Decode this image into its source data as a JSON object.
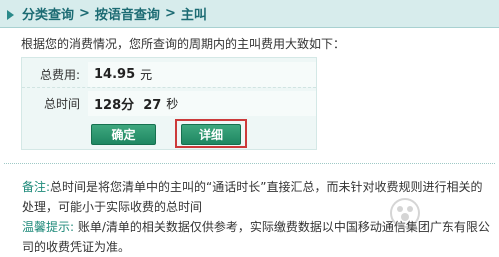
{
  "breadcrumb": {
    "items": [
      "分类查询",
      "按语音查询",
      "主叫"
    ],
    "separator": ">"
  },
  "intro": "根据您的消费情况，您所查询的周期内的主叫费用大致如下：",
  "summary": {
    "rows": [
      {
        "label": "总费用:",
        "value": "14.95",
        "unit": "元"
      },
      {
        "label": "总时间",
        "value": "128分  27",
        "unit": "秒"
      }
    ]
  },
  "buttons": {
    "confirm": "确定",
    "detail": "详细"
  },
  "notes": {
    "remark_key": "备注:",
    "remark_text": "总时间是将您清单中的主叫的“通话时长”直接汇总，而未针对收费规则进行相关的处理，可能小于实际收费的总时间",
    "tip_key": "温馨提示:",
    "tip_text": " 账单/清单的相关数据仅供参考，实际缴费数据以中国移动通信集团广东有限公司的收费凭证为准。"
  },
  "colors": {
    "header_bg": "#d7ecec",
    "accent": "#1c6b73",
    "button": "#2a9a70",
    "highlight": "#cc3a3a"
  }
}
